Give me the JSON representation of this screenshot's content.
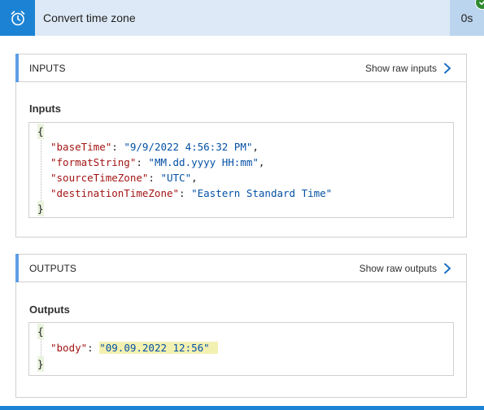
{
  "header": {
    "title": "Convert time zone",
    "duration": "0s",
    "icon": "alarm-clock-icon",
    "status_icon": "checkmark-icon",
    "accent_color": "#1c83d4",
    "success_color": "#2f8a2f"
  },
  "inputs_section": {
    "title": "INPUTS",
    "raw_link_label": "Show raw inputs",
    "sub_label": "Inputs",
    "json": {
      "open": "{",
      "close": "}",
      "lines": [
        {
          "key": "\"baseTime\"",
          "value": "\"9/9/2022 4:56:32 PM\"",
          "trailing": ","
        },
        {
          "key": "\"formatString\"",
          "value": "\"MM.dd.yyyy HH:mm\"",
          "trailing": ","
        },
        {
          "key": "\"sourceTimeZone\"",
          "value": "\"UTC\"",
          "trailing": ","
        },
        {
          "key": "\"destinationTimeZone\"",
          "value": "\"Eastern Standard Time\"",
          "trailing": ""
        }
      ]
    }
  },
  "outputs_section": {
    "title": "OUTPUTS",
    "raw_link_label": "Show raw outputs",
    "sub_label": "Outputs",
    "json": {
      "open": "{",
      "close": "}",
      "lines": [
        {
          "key": "\"body\"",
          "value": "\"09.09.2022 12:56\"",
          "trailing": ""
        }
      ]
    }
  }
}
